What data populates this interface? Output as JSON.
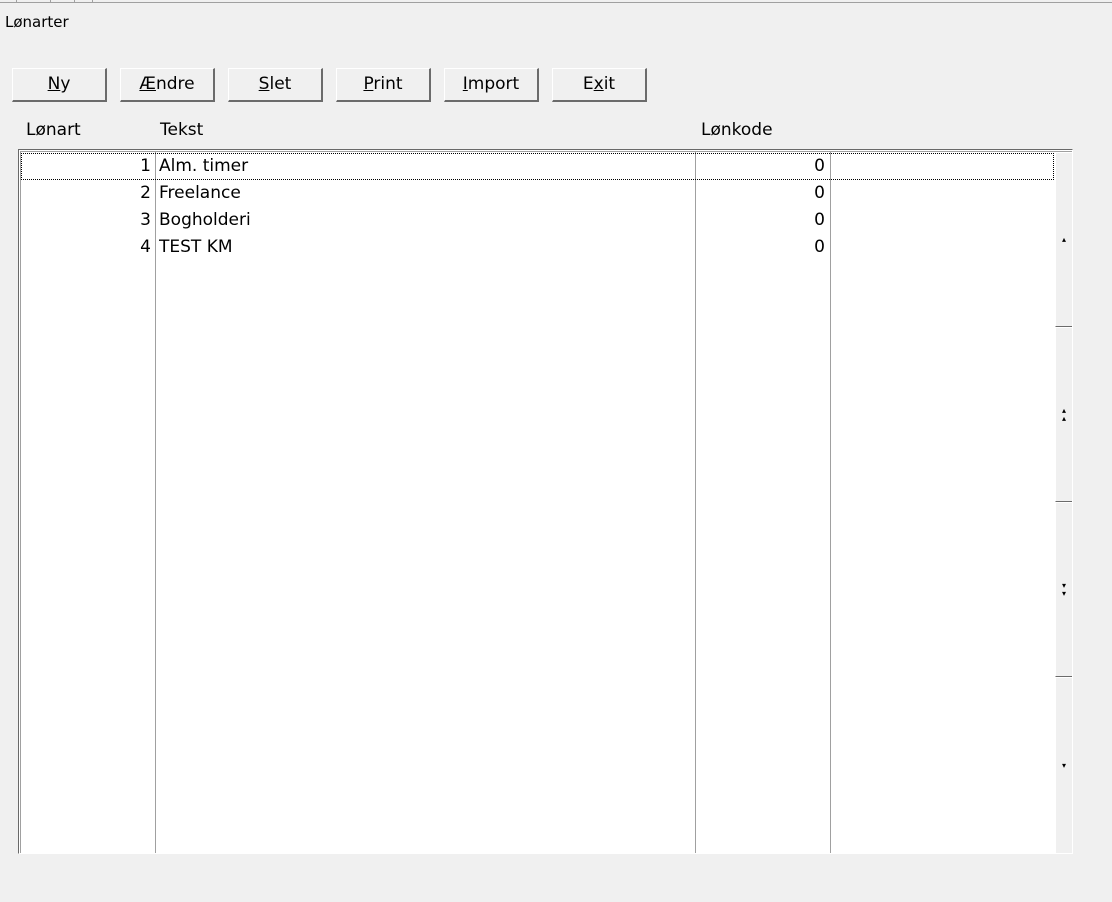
{
  "window": {
    "title": "Lønarter"
  },
  "toolbar": [
    {
      "label_acc": "N",
      "label_rest": "y",
      "label_pre": ""
    },
    {
      "label_acc": "Æ",
      "label_rest": "ndre",
      "label_pre": ""
    },
    {
      "label_acc": "S",
      "label_rest": "let",
      "label_pre": ""
    },
    {
      "label_acc": "P",
      "label_rest": "rint",
      "label_pre": ""
    },
    {
      "label_acc": "I",
      "label_rest": "mport",
      "label_pre": ""
    },
    {
      "label_acc": "x",
      "label_rest": "it",
      "label_pre": "E"
    }
  ],
  "list": {
    "columns": [
      "Lønart",
      "Tekst",
      "Lønkode"
    ],
    "rows": [
      {
        "lonart": "1",
        "tekst": "Alm. timer",
        "lonkode": "0"
      },
      {
        "lonart": "2",
        "tekst": "Freelance",
        "lonkode": "0"
      },
      {
        "lonart": "3",
        "tekst": "Bogholderi",
        "lonkode": "0"
      },
      {
        "lonart": "4",
        "tekst": "TEST KM",
        "lonkode": "0"
      }
    ],
    "selected_row": 1
  },
  "scrollbar": {
    "icons": [
      "scroll-up-icon",
      "page-up-icon",
      "page-down-icon",
      "scroll-down-icon"
    ]
  }
}
